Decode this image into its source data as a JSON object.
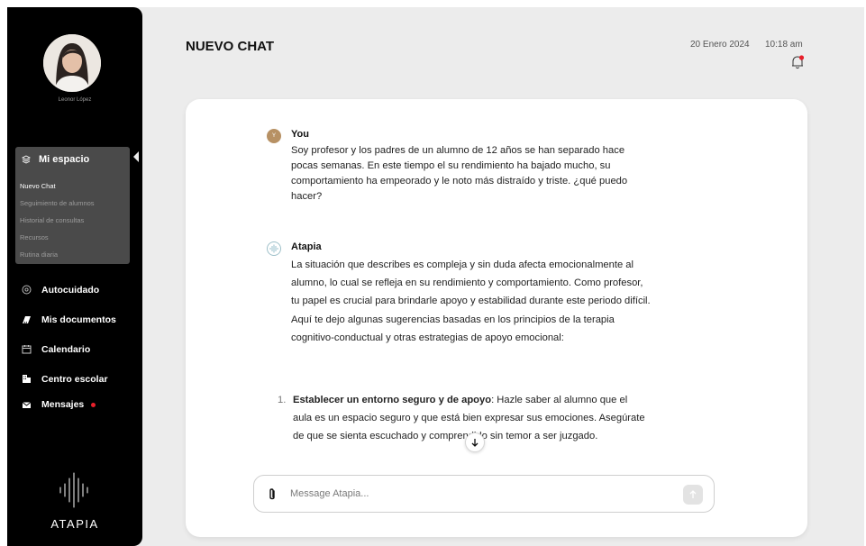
{
  "sidebar": {
    "user_name": "Leonor López",
    "my_space": {
      "label": "Mi espacio",
      "items": [
        {
          "label": "Nuevo Chat"
        },
        {
          "label": "Seguimiento de alumnos"
        },
        {
          "label": "Historial de consultas"
        },
        {
          "label": "Recursos"
        },
        {
          "label": "Rutina diaria"
        }
      ]
    },
    "nav": [
      {
        "label": "Autocuidado",
        "icon": "self-care-icon"
      },
      {
        "label": "Mis documentos",
        "icon": "documents-icon"
      },
      {
        "label": "Calendario",
        "icon": "calendar-icon"
      },
      {
        "label": "Centro escolar",
        "icon": "building-icon"
      },
      {
        "label": "Mensajes",
        "icon": "mail-icon",
        "notification": true
      }
    ],
    "logo_text": "ATAPIA"
  },
  "header": {
    "title": "NUEVO CHAT",
    "date": "20 Enero 2024",
    "time": "10:18 am"
  },
  "chat": {
    "messages": [
      {
        "author": "You",
        "avatar_letter": "Y",
        "text": "Soy profesor y los padres de un alumno de 12 años se han separado hace pocas semanas. En este tiempo el su rendimiento ha bajado mucho, su comportamiento ha empeorado y le noto más distraído y triste. ¿qué puedo hacer?"
      },
      {
        "author": "Atapia",
        "text": "La situación que describes es compleja y sin duda afecta emocionalmente al alumno, lo cual se refleja en su rendimiento y comportamiento. Como profesor, tu papel es crucial para brindarle apoyo y estabilidad durante este periodo difícil. Aquí te dejo algunas sugerencias basadas en los principios de la terapia cognitivo-conductual y otras estrategias de apoyo emocional:",
        "list": [
          {
            "number": "1.",
            "title": "Establecer un entorno seguro y de apoyo",
            "text": ": Hazle saber al alumno que el aula es un espacio seguro y que está bien expresar sus emociones. Asegúrate de que se sienta escuchado y comprendido sin temor a ser juzgado."
          }
        ]
      }
    ],
    "input_placeholder": "Message Atapia..."
  },
  "colors": {
    "sidebar_bg": "#000000",
    "active_box": "#4a4a4a",
    "page_bg": "#ececec",
    "notification": "#e8202b",
    "user_badge": "#b79164"
  }
}
